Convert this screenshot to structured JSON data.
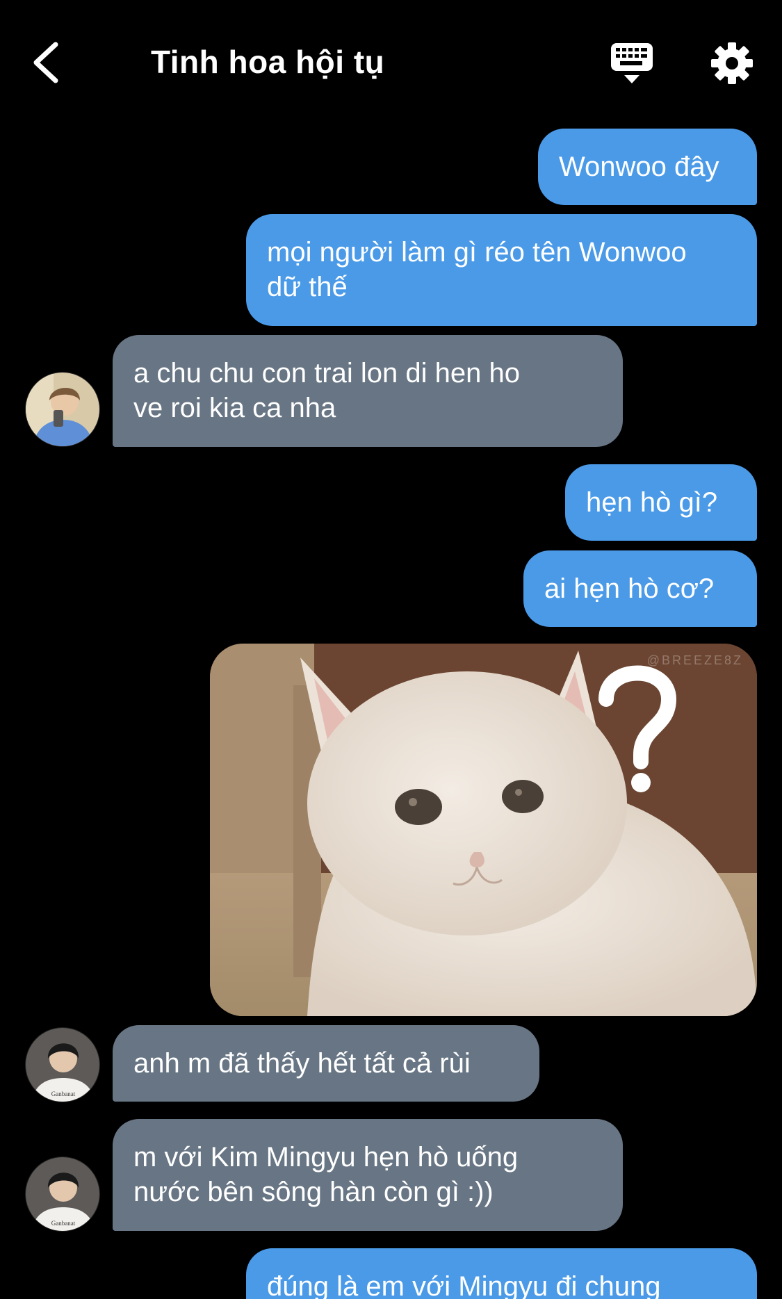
{
  "header": {
    "title": "Tinh hoa hội tụ",
    "back_icon": "chevron-left-icon",
    "keyboard_icon": "keyboard-icon",
    "settings_icon": "gear-icon"
  },
  "colors": {
    "background": "#000000",
    "outgoing_bubble": "#4a9ae8",
    "incoming_bubble": "#677584",
    "text": "#ffffff"
  },
  "messages": [
    {
      "direction": "out",
      "lines": [
        "Wonwoo đây"
      ]
    },
    {
      "direction": "out",
      "lines": [
        "mọi người làm gì réo tên Wonwoo",
        "dữ thế"
      ]
    },
    {
      "direction": "in",
      "lines": [
        "a chu chu con trai lon di hen ho",
        "ve roi kia ca nha"
      ]
    },
    {
      "direction": "out",
      "lines": [
        "hẹn hò gì?"
      ]
    },
    {
      "direction": "out",
      "lines": [
        "ai hẹn hò cơ?"
      ]
    },
    {
      "direction": "out",
      "type": "image",
      "image_subject": "confused white cat with question mark",
      "watermark": "@BREEZE8Z"
    },
    {
      "direction": "in",
      "lines": [
        "anh m đã thấy hết tất cả rùi"
      ]
    },
    {
      "direction": "in",
      "lines": [
        "m với Kim Mingyu hẹn hò uống",
        "nước bên sông hàn còn gì :))"
      ]
    },
    {
      "direction": "out",
      "lines": [
        "đúng là em với Mingyu đi chung"
      ]
    }
  ]
}
